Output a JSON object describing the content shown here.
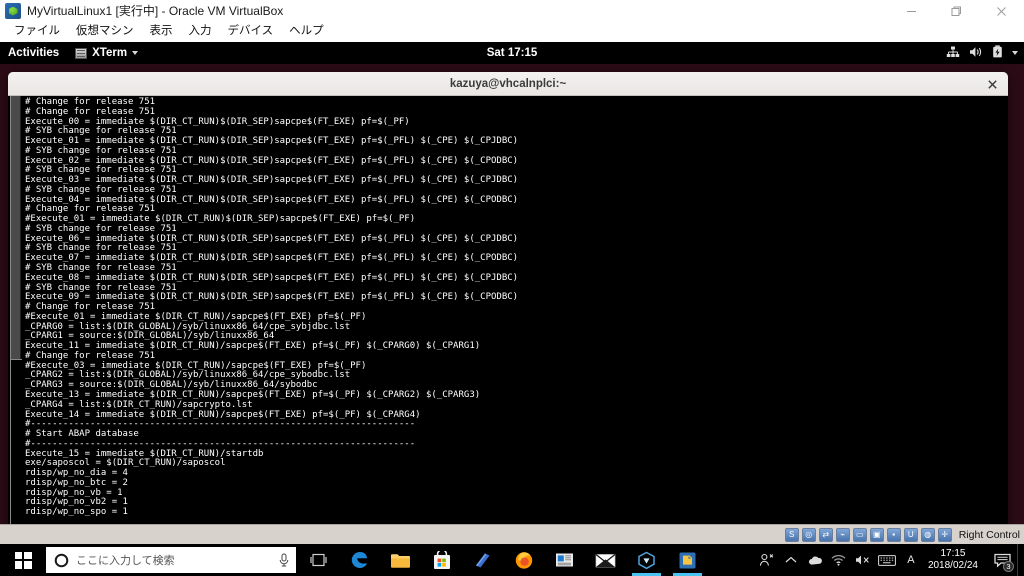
{
  "host_window": {
    "title": "MyVirtualLinux1 [実行中] - Oracle VM VirtualBox",
    "app_icon": "virtualbox-icon",
    "controls": {
      "minimize": "minimize-icon",
      "maximize": "restore-icon",
      "close": "close-icon"
    },
    "menu": [
      {
        "label": "ファイル"
      },
      {
        "label": "仮想マシン"
      },
      {
        "label": "表示"
      },
      {
        "label": "入力"
      },
      {
        "label": "デバイス"
      },
      {
        "label": "ヘルプ"
      }
    ]
  },
  "guest": {
    "panel": {
      "activities": "Activities",
      "app_menu_label": "XTerm",
      "app_menu_icon": "xterm-icon",
      "clock": "Sat 17:15",
      "status_icons": [
        {
          "name": "network-icon"
        },
        {
          "name": "volume-icon"
        },
        {
          "name": "battery-icon"
        },
        {
          "name": "chevron-down-icon"
        }
      ]
    },
    "terminal": {
      "title": "kazuya@vhcalnplci:~",
      "close_icon": "close-icon",
      "lines": [
        "# Change for release 751",
        "# Change for release 751",
        "Execute_00 = immediate $(DIR_CT_RUN)$(DIR_SEP)sapcpe$(FT_EXE) pf=$(_PF)",
        "# SYB change for release 751",
        "Execute_01 = immediate $(DIR_CT_RUN)$(DIR_SEP)sapcpe$(FT_EXE) pf=$(_PFL) $(_CPE) $(_CPJDBC)",
        "# SYB change for release 751",
        "Execute_02 = immediate $(DIR_CT_RUN)$(DIR_SEP)sapcpe$(FT_EXE) pf=$(_PFL) $(_CPE) $(_CPODBC)",
        "# SYB change for release 751",
        "Execute_03 = immediate $(DIR_CT_RUN)$(DIR_SEP)sapcpe$(FT_EXE) pf=$(_PFL) $(_CPE) $(_CPJDBC)",
        "# SYB change for release 751",
        "Execute_04 = immediate $(DIR_CT_RUN)$(DIR_SEP)sapcpe$(FT_EXE) pf=$(_PFL) $(_CPE) $(_CPODBC)",
        "# Change for release 751",
        "#Execute_01 = immediate $(DIR_CT_RUN)$(DIR_SEP)sapcpe$(FT_EXE) pf=$(_PF)",
        "# SYB change for release 751",
        "Execute_06 = immediate $(DIR_CT_RUN)$(DIR_SEP)sapcpe$(FT_EXE) pf=$(_PFL) $(_CPE) $(_CPJDBC)",
        "# SYB change for release 751",
        "Execute_07 = immediate $(DIR_CT_RUN)$(DIR_SEP)sapcpe$(FT_EXE) pf=$(_PFL) $(_CPE) $(_CPODBC)",
        "# SYB change for release 751",
        "Execute_08 = immediate $(DIR_CT_RUN)$(DIR_SEP)sapcpe$(FT_EXE) pf=$(_PFL) $(_CPE) $(_CPJDBC)",
        "# SYB change for release 751",
        "Execute_09 = immediate $(DIR_CT_RUN)$(DIR_SEP)sapcpe$(FT_EXE) pf=$(_PFL) $(_CPE) $(_CPODBC)",
        "# Change for release 751",
        "#Execute_01 = immediate $(DIR_CT_RUN)/sapcpe$(FT_EXE) pf=$(_PF)",
        "_CPARG0 = list:$(DIR_GLOBAL)/syb/linuxx86_64/cpe_sybjdbc.lst",
        "_CPARG1 = source:$(DIR_GLOBAL)/syb/linuxx86_64",
        "Execute_11 = immediate $(DIR_CT_RUN)/sapcpe$(FT_EXE) pf=$(_PF) $(_CPARG0) $(_CPARG1)",
        "# Change for release 751",
        "#Execute_03 = immediate $(DIR_CT_RUN)/sapcpe$(FT_EXE) pf=$(_PF)",
        "_CPARG2 = list:$(DIR_GLOBAL)/syb/linuxx86_64/cpe_sybodbc.lst",
        "_CPARG3 = source:$(DIR_GLOBAL)/syb/linuxx86_64/sybodbc",
        "Execute_13 = immediate $(DIR_CT_RUN)/sapcpe$(FT_EXE) pf=$(_PF) $(_CPARG2) $(_CPARG3)",
        "_CPARG4 = list:$(DIR_CT_RUN)/sapcrypto.lst",
        "Execute_14 = immediate $(DIR_CT_RUN)/sapcpe$(FT_EXE) pf=$(_PF) $(_CPARG4)",
        "#-----------------------------------------------------------------------",
        "# Start ABAP database",
        "#-----------------------------------------------------------------------",
        "Execute_15 = immediate $(DIR_CT_RUN)/startdb",
        "exe/saposcol = $(DIR_CT_RUN)/saposcol",
        "rdisp/wp_no_dia = 4",
        "rdisp/wp_no_btc = 2",
        "rdisp/wp_no_vb = 1",
        "rdisp/wp_no_vb2 = 1",
        "rdisp/wp_no_spo = 1"
      ]
    }
  },
  "vbox_statusbar": {
    "icons": [
      {
        "name": "harddisk-icon"
      },
      {
        "name": "optical-disk-icon"
      },
      {
        "name": "network-adapter-icon"
      },
      {
        "name": "usb-icon"
      },
      {
        "name": "shared-folder-icon"
      },
      {
        "name": "display-icon"
      },
      {
        "name": "recording-icon"
      },
      {
        "name": "mouse-integration-icon"
      },
      {
        "name": "globe-icon"
      },
      {
        "name": "host-key-icon"
      }
    ],
    "host_key_label": "Right Control"
  },
  "windows_taskbar": {
    "start_icon": "windows-logo-icon",
    "search": {
      "icon": "cortana-circle-icon",
      "placeholder": "ここに入力して検索",
      "mic_icon": "microphone-icon"
    },
    "apps": [
      {
        "name": "task-view-icon",
        "active": false
      },
      {
        "name": "edge-browser-icon",
        "active": false
      },
      {
        "name": "file-explorer-icon",
        "active": false
      },
      {
        "name": "microsoft-store-icon",
        "active": false
      },
      {
        "name": "onenote-icon",
        "active": false
      },
      {
        "name": "firefox-icon",
        "active": false
      },
      {
        "name": "news-app-icon",
        "active": false
      },
      {
        "name": "mail-icon",
        "active": false
      },
      {
        "name": "virtualbox-icon",
        "active": true
      },
      {
        "name": "virtualbox-vm-icon",
        "active": true
      }
    ],
    "tray": {
      "icons": [
        {
          "name": "people-icon"
        },
        {
          "name": "show-hidden-icons-chevron-icon"
        },
        {
          "name": "onedrive-icon"
        },
        {
          "name": "wifi-icon"
        },
        {
          "name": "volume-muted-icon"
        },
        {
          "name": "keyboard-ime-icon"
        },
        {
          "name": "ime-mode-a-icon"
        }
      ],
      "clock_time": "17:15",
      "clock_date": "2018/02/24",
      "notification_icon": "action-center-icon",
      "notification_count": "3"
    }
  }
}
